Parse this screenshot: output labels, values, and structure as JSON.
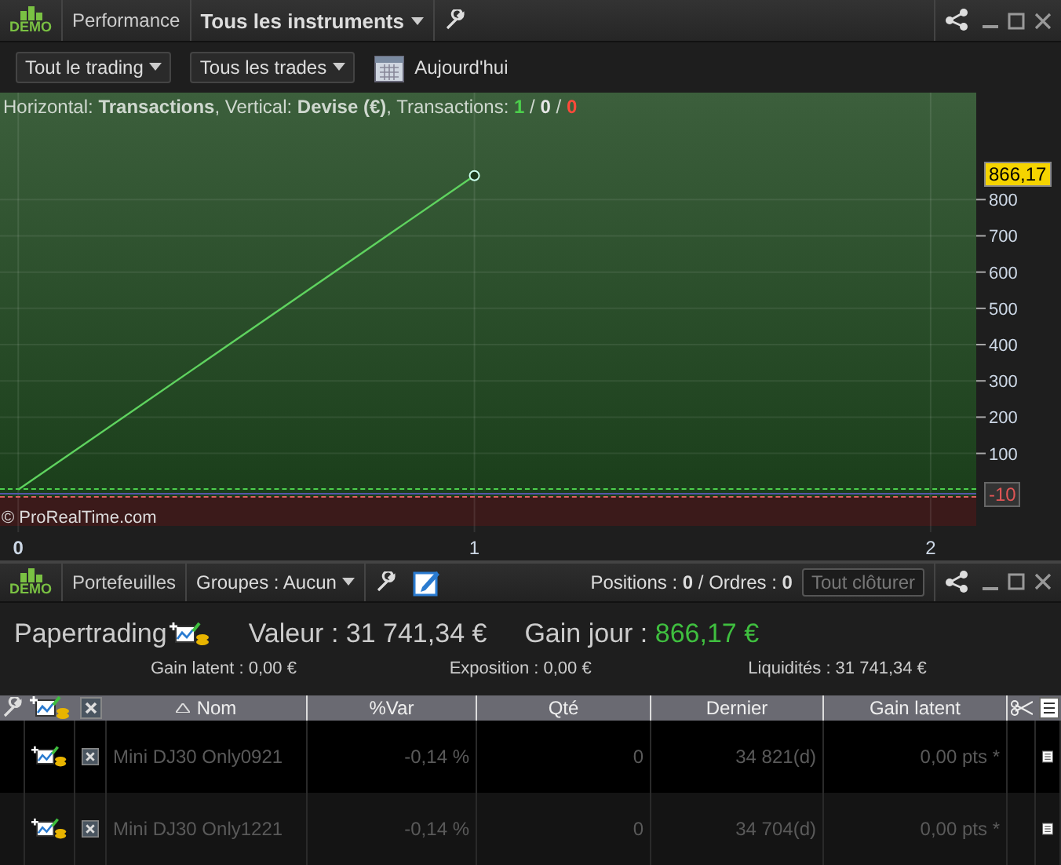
{
  "window": {
    "badge": "DEMO",
    "title": "Performance",
    "instrument_menu": "Tous les instruments"
  },
  "toolbar": {
    "scope_menu": "Tout le trading",
    "trades_menu": "Tous les trades",
    "date_button": "Aujourd'hui"
  },
  "chart": {
    "legend": "Horizontal: **Transactions**, Vertical: **Devise (€)**, Transactions: ",
    "separator": "/",
    "transaction_counts": [
      {
        "value": "1",
        "color": "#4cd04c"
      },
      {
        "value": "0",
        "color": "#e6e6e6"
      },
      {
        "value": "0",
        "color": "#ff4a3a"
      }
    ],
    "last_value_label": "866,17",
    "min_value_label": "-10",
    "copyright": "© ProRealTime.com",
    "chart_data": {
      "type": "line",
      "x": [
        0,
        1
      ],
      "series": [
        {
          "color": "#5fd35f",
          "values": [
            0,
            866.17
          ]
        }
      ],
      "xlim": [
        -0.04,
        2.1
      ],
      "ylim": [
        -100,
        1095
      ],
      "grid": true,
      "xticks": [
        0,
        1,
        2
      ],
      "yticks": [
        100,
        200,
        300,
        400,
        500,
        600,
        700,
        800
      ]
    }
  },
  "portfolio_bar": {
    "badge": "DEMO",
    "title": "Portefeuilles",
    "groups_menu": "Groupes : Aucun",
    "counts": "Positions : **0** / Ordres : **0**",
    "close_all_button": {
      "label": "Tout clôturer",
      "disabled": true
    }
  },
  "summary": {
    "account": "Papertrading",
    "value": "Valeur : 31 741,34 €",
    "day_gain_label": "Gain jour : ",
    "day_gain": "866,17 €",
    "details": [
      "Gain latent : 0,00 €",
      "Exposition : 0,00 €",
      "Liquidités : 31 741,34 €"
    ]
  },
  "table": {
    "columns": [
      "Nom",
      "%Var",
      "Qté",
      "Dernier",
      "Gain latent"
    ],
    "rows": [
      {
        "name": "Mini DJ30 Only0921",
        "var": "-0,14 %",
        "qty": "0",
        "last": "34 821(d)",
        "gain": "0,00 pts *"
      },
      {
        "name": "Mini DJ30 Only1221",
        "var": "-0,14 %",
        "qty": "0",
        "last": "34 704(d)",
        "gain": "0,00 pts *"
      }
    ]
  }
}
